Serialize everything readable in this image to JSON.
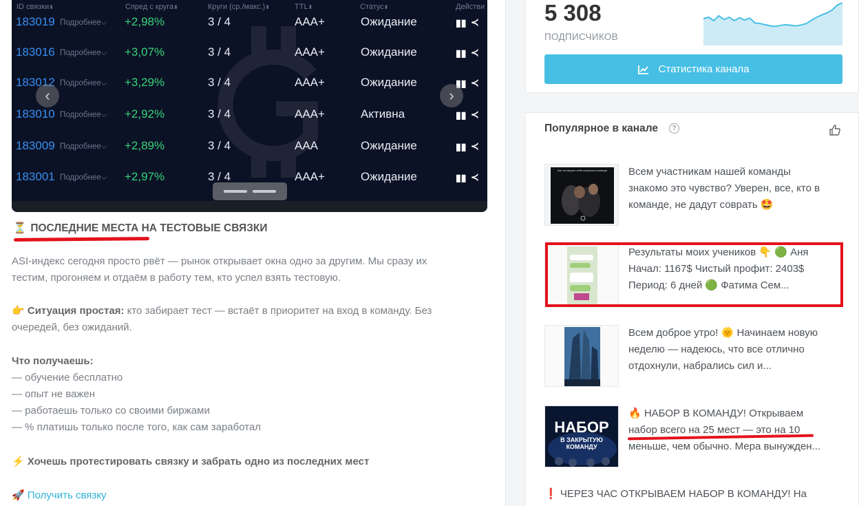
{
  "screenshot": {
    "headers": {
      "id": "ID связки",
      "spread": "Спред с круга",
      "rounds": "Круги (ср./макс.)",
      "ttl": "TTL",
      "status": "Статус",
      "actions": "Действи"
    },
    "more_label": "Подробнее",
    "rows": [
      {
        "id": "183019",
        "spread": "+2,98%",
        "rounds": "3 / 4",
        "ttl": "AAA+",
        "status": "Ожидание"
      },
      {
        "id": "183016",
        "spread": "+3,07%",
        "rounds": "3 / 4",
        "ttl": "AAA+",
        "status": "Ожидание"
      },
      {
        "id": "183012",
        "spread": "+3,29%",
        "rounds": "3 / 4",
        "ttl": "AAA+",
        "status": "Ожидание"
      },
      {
        "id": "183010",
        "spread": "+2,92%",
        "rounds": "3 / 4",
        "ttl": "AAA+",
        "status": "Активна"
      },
      {
        "id": "183009",
        "spread": "+2,89%",
        "rounds": "3 / 4",
        "ttl": "AAA",
        "status": "Ожидание"
      },
      {
        "id": "183001",
        "spread": "+2,97%",
        "rounds": "3 / 4",
        "ttl": "AAA+",
        "status": "Ожидание"
      }
    ]
  },
  "post": {
    "title_emoji": "⏳",
    "title": "ПОСЛЕДНИЕ МЕСТА НА ТЕСТОВЫЕ СВЯЗКИ",
    "para1_line1": "ASI-индекс сегодня просто рвёт — рынок открывает окна одно за другим. Мы сразу их",
    "para1_line2": "тестим, прогоняем и отдаём в работу тем, кто успел взять тестовую.",
    "para2_emoji": "👉",
    "para2_bold": "Ситуация простая:",
    "para2_rest": " кто забирает тест — встаёт в приоритет на вход в команду. Без",
    "para2_line2": "очередей, без ожиданий.",
    "what_title": "Что получаешь:",
    "list": [
      "— обучение бесплатно",
      "— опыт не важен",
      "— работаешь только со своими биржами",
      "— % платишь только после того, как сам заработал"
    ],
    "cta_emoji": "⚡",
    "cta": "Хочешь протестировать связку и забрать одно из последних мест",
    "link_emoji": "🚀",
    "link": "Получить связку"
  },
  "channel": {
    "subscribers": "5 308",
    "subscribers_label": "ПОДПИСЧИКОВ",
    "stats_button": "Статистика канала",
    "popular_title": "Популярное в канале",
    "items": [
      {
        "lines": [
          "Всем участникам нашей команды",
          "знакомо это чувство? Уверен, все, кто в",
          "команде, не дадут соврать 🤩"
        ]
      },
      {
        "lines": [
          "Результаты моих учеников 👇 🟢 Аня",
          "Начал: 1167$ Чистый профит: 2403$",
          "Период: 6 дней 🟢 Фатима Сем..."
        ]
      },
      {
        "lines": [
          "Всем доброе утро! 🌞 Начинаем новую",
          "неделю — надеюсь, что все отлично",
          "отдохнули, набрались сил и..."
        ]
      },
      {
        "lines": [
          "🔥 НАБОР В КОМАНДУ! Открываем",
          "набор всего на 25 мест — это на 10",
          "меньше, чем обычно. Мера вынужден..."
        ]
      }
    ],
    "last_line": "❗ ЧЕРЕЗ ЧАС ОТКРЫВАЕМ НАБОР В КОМАНДУ! На",
    "thumb1_caption": "Как тестируют себя новички в команде",
    "thumb4_big": "НАБОР",
    "thumb4_small1": "В ЗАКРЫТУЮ",
    "thumb4_small2": "КОМАНДУ"
  },
  "colors": {
    "accent": "#47bfe4",
    "highlight_red": "#e3121b",
    "spread_green": "#38d27a",
    "id_blue": "#3a8ff0",
    "dark_bg": "#0b1226"
  },
  "sparkline": [
    0.55,
    0.5,
    0.62,
    0.45,
    0.58,
    0.5,
    0.62,
    0.52,
    0.6,
    0.53,
    0.7,
    0.72,
    0.76,
    0.8,
    0.82,
    0.78,
    0.76,
    0.78,
    0.8,
    0.77,
    0.72,
    0.6,
    0.5,
    0.42,
    0.35,
    0.25,
    0.08,
    0.0
  ]
}
